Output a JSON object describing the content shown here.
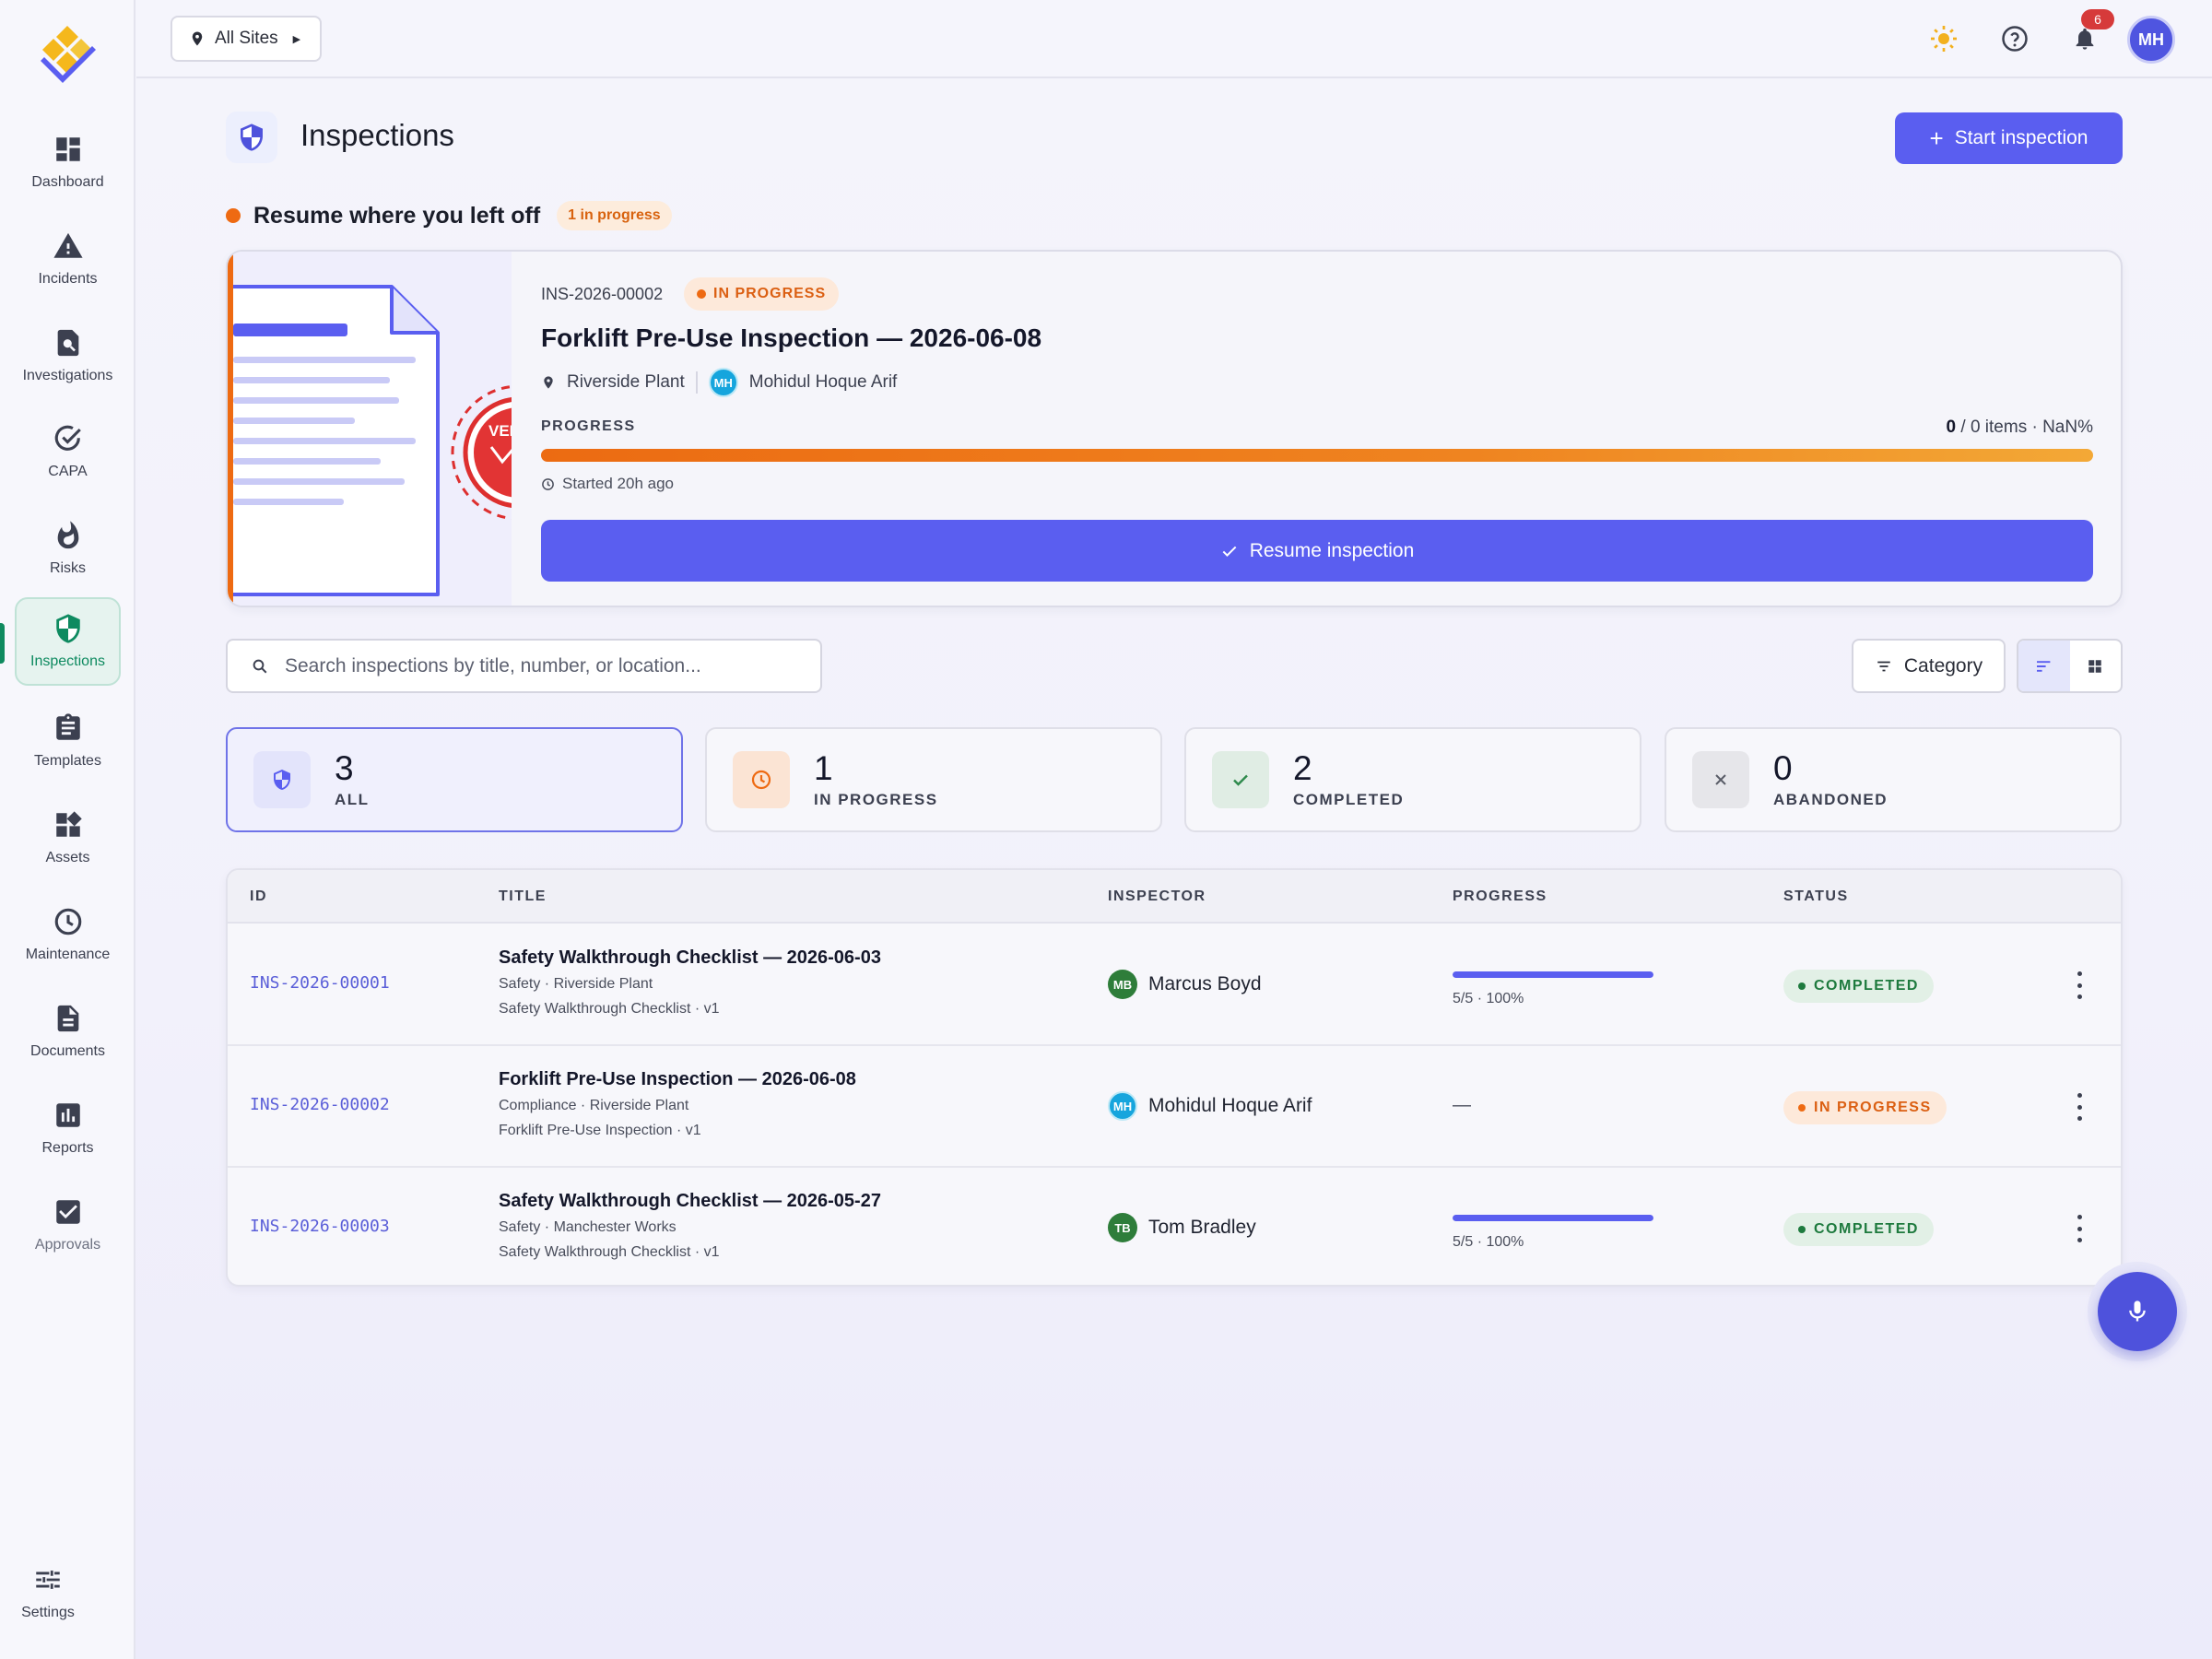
{
  "sidebar": {
    "items": [
      {
        "label": "Dashboard",
        "icon": "dashboard-icon"
      },
      {
        "label": "Incidents",
        "icon": "warning-icon"
      },
      {
        "label": "Investigations",
        "icon": "search-document-icon"
      },
      {
        "label": "CAPA",
        "icon": "check-circle-icon"
      },
      {
        "label": "Risks",
        "icon": "flame-icon"
      },
      {
        "label": "Inspections",
        "icon": "shield-icon"
      },
      {
        "label": "Templates",
        "icon": "clipboard-icon"
      },
      {
        "label": "Assets",
        "icon": "widgets-icon"
      },
      {
        "label": "Maintenance",
        "icon": "clock-icon"
      },
      {
        "label": "Documents",
        "icon": "document-icon"
      },
      {
        "label": "Reports",
        "icon": "bar-chart-icon"
      },
      {
        "label": "Approvals",
        "icon": "checkbox-icon"
      }
    ],
    "active": "Inspections",
    "settings_label": "Settings"
  },
  "topbar": {
    "site_selector": "All Sites",
    "notification_count": "6",
    "user_initials": "MH"
  },
  "header": {
    "title": "Inspections",
    "start_button": "Start inspection"
  },
  "resume": {
    "heading": "Resume where you left off",
    "count_badge": "1 in progress",
    "id": "INS-2026-00002",
    "status": "IN PROGRESS",
    "title": "Forklift Pre-Use Inspection — 2026-06-08",
    "location": "Riverside Plant",
    "inspector_initials": "MH",
    "inspector": "Mohidul Hoque Arif",
    "progress_label": "PROGRESS",
    "progress_done": "0",
    "progress_rest": "/ 0 items · NaN%",
    "started": "Started 20h ago",
    "resume_button": "Resume inspection",
    "illustration_text": "VER"
  },
  "search": {
    "placeholder": "Search inspections by title, number, or location..."
  },
  "filters": {
    "category_label": "Category",
    "view_mode": "list"
  },
  "stats": [
    {
      "value": "3",
      "label": "ALL",
      "icon": "shield-icon",
      "color": "#5a5ef0"
    },
    {
      "value": "1",
      "label": "IN PROGRESS",
      "icon": "clock-icon",
      "color": "#ee6a12"
    },
    {
      "value": "2",
      "label": "COMPLETED",
      "icon": "check-icon",
      "color": "#2e8a4c"
    },
    {
      "value": "0",
      "label": "ABANDONED",
      "icon": "close-icon",
      "color": "#5a5d68"
    }
  ],
  "table": {
    "columns": [
      "ID",
      "TITLE",
      "INSPECTOR",
      "PROGRESS",
      "STATUS"
    ],
    "rows": [
      {
        "id": "INS-2026-00001",
        "title": "Safety Walkthrough Checklist — 2026-06-03",
        "subtitle": "Safety · Riverside Plant",
        "template": "Safety Walkthrough Checklist · v1",
        "inspector_initials": "MB",
        "inspector": "Marcus Boyd",
        "avatar_color": "#2e7d3a",
        "progress_text": "5/5 · 100%",
        "progress": 1.0,
        "status": "COMPLETED"
      },
      {
        "id": "INS-2026-00002",
        "title": "Forklift Pre-Use Inspection — 2026-06-08",
        "subtitle": "Compliance · Riverside Plant",
        "template": "Forklift Pre-Use Inspection · v1",
        "inspector_initials": "MH",
        "inspector": "Mohidul Hoque Arif",
        "avatar_color": "#16a5dd",
        "progress_text": "—",
        "status": "IN PROGRESS"
      },
      {
        "id": "INS-2026-00003",
        "title": "Safety Walkthrough Checklist — 2026-05-27",
        "subtitle": "Safety · Manchester Works",
        "template": "Safety Walkthrough Checklist · v1",
        "inspector_initials": "TB",
        "inspector": "Tom Bradley",
        "avatar_color": "#2e7d3a",
        "progress_text": "5/5 · 100%",
        "progress": 1.0,
        "status": "COMPLETED"
      }
    ]
  },
  "colors": {
    "accent": "#5a5ef0",
    "active_nav": "#0e8a60",
    "in_progress": "#ee6a12",
    "completed": "#1e7a3e"
  }
}
